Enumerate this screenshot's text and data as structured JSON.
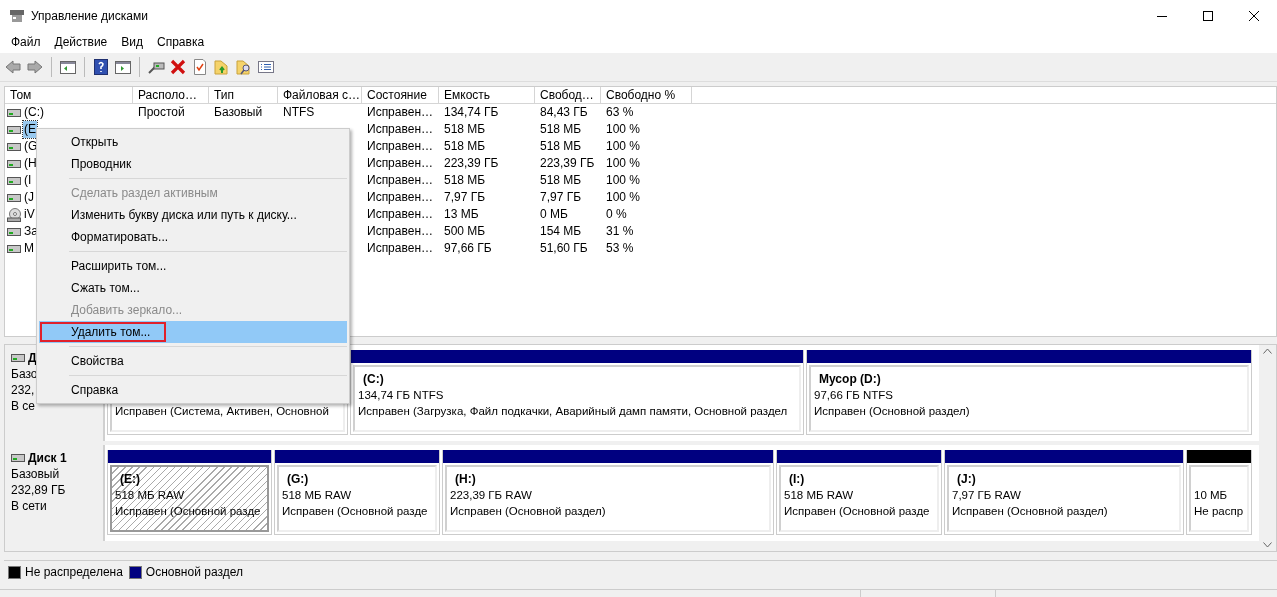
{
  "window": {
    "title": "Управление дисками"
  },
  "menu_bar": [
    "Файл",
    "Действие",
    "Вид",
    "Справка"
  ],
  "table": {
    "columns": [
      "Том",
      "Располо…",
      "Тип",
      "Файловая с…",
      "Состояние",
      "Емкость",
      "Свобод…",
      "Свободно %"
    ],
    "rows": [
      {
        "kind": "disk",
        "volume": "(C:)",
        "layout": "Простой",
        "type": "Базовый",
        "fs": "NTFS",
        "status": "Исправен…",
        "capacity": "134,74 ГБ",
        "free": "84,43 ГБ",
        "free_pct": "63 %",
        "selected": false
      },
      {
        "kind": "disk",
        "volume": "(E",
        "status": "Исправен…",
        "capacity": "518 МБ",
        "free": "518 МБ",
        "free_pct": "100 %",
        "selected": true
      },
      {
        "kind": "disk",
        "volume": "(G",
        "status": "Исправен…",
        "capacity": "518 МБ",
        "free": "518 МБ",
        "free_pct": "100 %",
        "selected": false
      },
      {
        "kind": "disk",
        "volume": "(H",
        "status": "Исправен…",
        "capacity": "223,39 ГБ",
        "free": "223,39 ГБ",
        "free_pct": "100 %",
        "selected": false
      },
      {
        "kind": "disk",
        "volume": "(I",
        "status": "Исправен…",
        "capacity": "518 МБ",
        "free": "518 МБ",
        "free_pct": "100 %",
        "selected": false
      },
      {
        "kind": "disk",
        "volume": "(J",
        "status": "Исправен…",
        "capacity": "7,97 ГБ",
        "free": "7,97 ГБ",
        "free_pct": "100 %",
        "selected": false
      },
      {
        "kind": "cd",
        "volume": "iV",
        "status": "Исправен…",
        "capacity": "13 МБ",
        "free": "0 МБ",
        "free_pct": "0 %",
        "selected": false
      },
      {
        "kind": "disk",
        "volume": "За",
        "status": "Исправен…",
        "capacity": "500 МБ",
        "free": "154 МБ",
        "free_pct": "31 %",
        "selected": false
      },
      {
        "kind": "disk",
        "volume": "М",
        "status": "Исправен…",
        "capacity": "97,66 ГБ",
        "free": "51,60 ГБ",
        "free_pct": "53 %",
        "selected": false
      }
    ]
  },
  "context_menu": {
    "items": [
      {
        "kind": "item",
        "label": "Открыть",
        "disabled": false,
        "highlighted": false,
        "marked": false
      },
      {
        "kind": "item",
        "label": "Проводник",
        "disabled": false,
        "highlighted": false,
        "marked": false
      },
      {
        "kind": "separator"
      },
      {
        "kind": "item",
        "label": "Сделать раздел активным",
        "disabled": true,
        "highlighted": false,
        "marked": false
      },
      {
        "kind": "item",
        "label": "Изменить букву диска или путь к диску...",
        "disabled": false,
        "highlighted": false,
        "marked": false
      },
      {
        "kind": "item",
        "label": "Форматировать...",
        "disabled": false,
        "highlighted": false,
        "marked": false
      },
      {
        "kind": "separator"
      },
      {
        "kind": "item",
        "label": "Расширить том...",
        "disabled": false,
        "highlighted": false,
        "marked": false
      },
      {
        "kind": "item",
        "label": "Сжать том...",
        "disabled": false,
        "highlighted": false,
        "marked": false
      },
      {
        "kind": "item",
        "label": "Добавить зеркало...",
        "disabled": true,
        "highlighted": false,
        "marked": false
      },
      {
        "kind": "item",
        "label": "Удалить том...",
        "disabled": false,
        "highlighted": true,
        "marked": true
      },
      {
        "kind": "separator"
      },
      {
        "kind": "item",
        "label": "Свойства",
        "disabled": false,
        "highlighted": false,
        "marked": false
      },
      {
        "kind": "separator"
      },
      {
        "kind": "item",
        "label": "Справка",
        "disabled": false,
        "highlighted": false,
        "marked": false
      }
    ]
  },
  "disks": [
    {
      "name": "Д",
      "type": "Базо",
      "size": "232,",
      "status": "В се",
      "partitions": [
        {
          "status": "Исправен (Система, Активен, Основной",
          "selected": false
        },
        {
          "kind": "primary",
          "title": "(C:)",
          "size": "134,74 ГБ NTFS",
          "status": "Исправен (Загрузка, Файл подкачки, Аварийный дамп памяти, Основной раздел",
          "selected": false
        },
        {
          "kind": "primary",
          "title": "Мусор  (D:)",
          "size": "97,66 ГБ NTFS",
          "status": "Исправен (Основной раздел)",
          "selected": false
        }
      ]
    },
    {
      "name": "Диск 1",
      "type": "Базовый",
      "size": "232,89 ГБ",
      "status": "В сети",
      "partitions": [
        {
          "kind": "primary",
          "title": "(E:)",
          "size": "518 МБ RAW",
          "status": "Исправен (Основной разде",
          "selected": true
        },
        {
          "kind": "primary",
          "title": "(G:)",
          "size": "518 МБ RAW",
          "status": "Исправен (Основной разде",
          "selected": false
        },
        {
          "kind": "primary",
          "title": "(H:)",
          "size": "223,39 ГБ RAW",
          "status": "Исправен (Основной раздел)",
          "selected": false
        },
        {
          "kind": "primary",
          "title": "(I:)",
          "size": "518 МБ RAW",
          "status": "Исправен (Основной разде",
          "selected": false
        },
        {
          "kind": "primary",
          "title": "(J:)",
          "size": "7,97 ГБ RAW",
          "status": "Исправен (Основной раздел)",
          "selected": false
        },
        {
          "kind": "unallocated",
          "size": "10 МБ",
          "status": "Не распр",
          "selected": false
        }
      ]
    }
  ],
  "legend": [
    {
      "label": "Не распределена",
      "color": "#000000"
    },
    {
      "label": "Основной раздел",
      "color": "#000080"
    }
  ]
}
